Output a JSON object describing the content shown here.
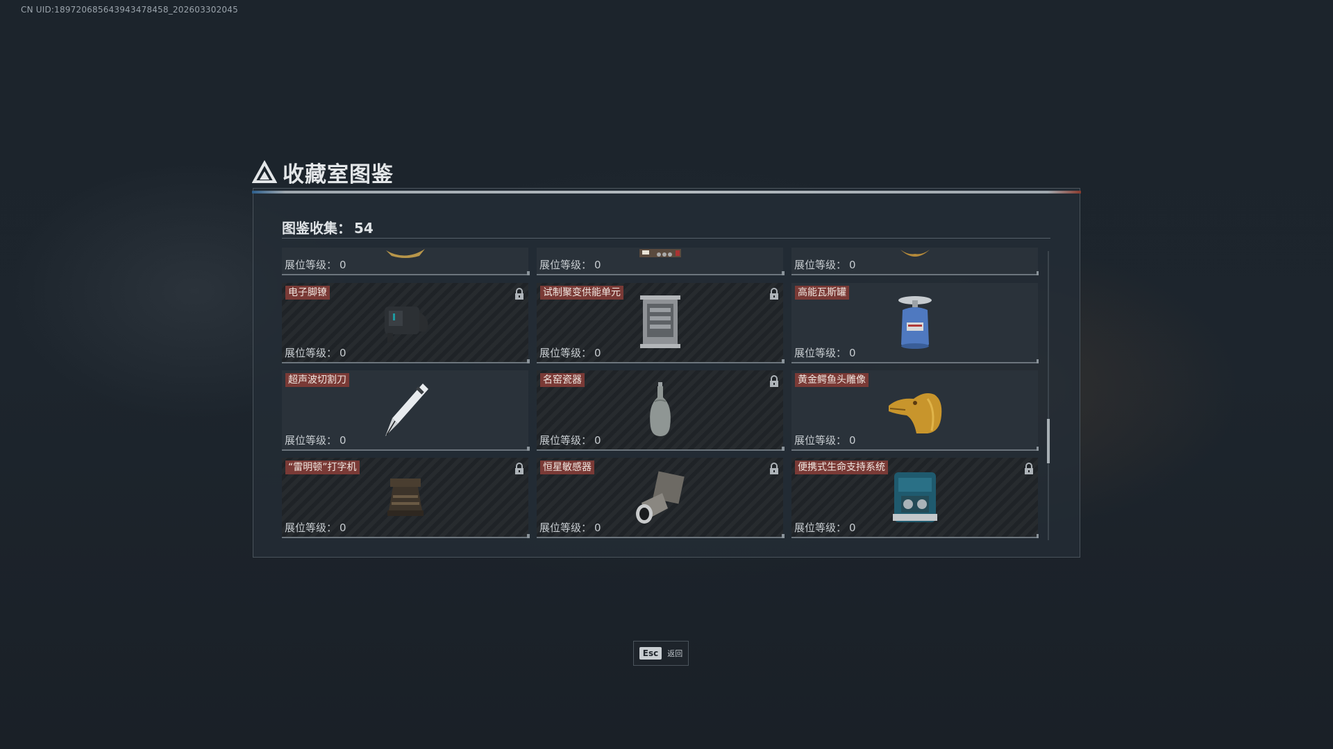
{
  "uid_text": "CN UID:189720685643943478458_202603302045",
  "title": "收藏室图鉴",
  "collection": {
    "label": "图鉴收集：",
    "count": "54"
  },
  "level_label": "展位等级：",
  "rows": [
    [
      {
        "name": "",
        "level": "0",
        "locked": false,
        "icon": "gold-relic-icon"
      },
      {
        "name": "",
        "level": "0",
        "locked": false,
        "icon": "device-box-icon"
      },
      {
        "name": "",
        "level": "0",
        "locked": false,
        "icon": "gold-ornament-icon"
      }
    ],
    [
      {
        "name": "电子脚镣",
        "level": "0",
        "locked": true,
        "icon": "ankle-monitor-icon"
      },
      {
        "name": "试制聚变供能单元",
        "level": "0",
        "locked": true,
        "icon": "fusion-unit-icon"
      },
      {
        "name": "高能瓦斯罐",
        "level": "0",
        "locked": false,
        "icon": "gas-canister-icon"
      }
    ],
    [
      {
        "name": "超声波切割刀",
        "level": "0",
        "locked": false,
        "icon": "ultrasonic-knife-icon"
      },
      {
        "name": "名窑瓷器",
        "level": "0",
        "locked": true,
        "icon": "porcelain-vase-icon"
      },
      {
        "name": "黄金鳄鱼头雕像",
        "level": "0",
        "locked": false,
        "icon": "gold-crocodile-statue-icon"
      }
    ],
    [
      {
        "name": "“雷明顿”打字机",
        "level": "0",
        "locked": true,
        "icon": "typewriter-icon"
      },
      {
        "name": "恒星敏感器",
        "level": "0",
        "locked": true,
        "icon": "star-sensor-icon"
      },
      {
        "name": "便携式生命支持系统",
        "level": "0",
        "locked": true,
        "icon": "life-support-icon"
      }
    ]
  ],
  "footer": {
    "key": "Esc",
    "label": "返回"
  }
}
